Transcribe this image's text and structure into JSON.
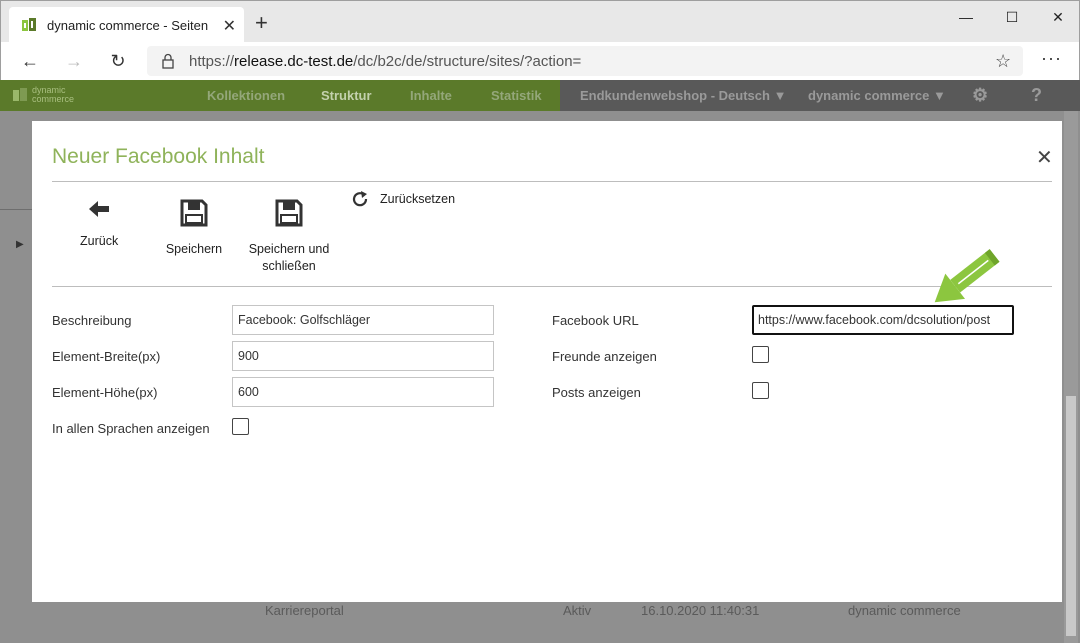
{
  "browser": {
    "tab_title": "dynamic commerce - Seiten",
    "url_prefix": "https://",
    "url_domain": "release.dc-test.de",
    "url_path": "/dc/b2c/de/structure/sites/?action="
  },
  "app": {
    "logo_line1": "dynamic",
    "logo_line2": "commerce",
    "nav": [
      "Kollektionen",
      "Struktur",
      "Inhalte",
      "Statistik"
    ],
    "shop_select": "Endkundenwebshop - Deutsch",
    "company_select": "dynamic commerce",
    "help": "?"
  },
  "background_row": {
    "name": "Karriereportal",
    "status": "Aktiv",
    "date": "16.10.2020 11:40:31",
    "owner": "dynamic commerce"
  },
  "modal": {
    "title": "Neuer Facebook Inhalt",
    "toolbar": {
      "back": "Zurück",
      "save": "Speichern",
      "save_close_1": "Speichern und",
      "save_close_2": "schließen",
      "reset": "Zurücksetzen"
    },
    "form": {
      "description_label": "Beschreibung",
      "description_value": "Facebook: Golfschläger",
      "width_label": "Element-Breite(px)",
      "width_value": "900",
      "height_label": "Element-Höhe(px)",
      "height_value": "600",
      "all_languages_label": "In allen Sprachen anzeigen",
      "fb_url_label": "Facebook URL",
      "fb_url_value": "https://www.facebook.com/dcsolution/post",
      "friends_label": "Freunde anzeigen",
      "posts_label": "Posts anzeigen"
    }
  },
  "colors": {
    "accent_green": "#8fb35a",
    "header_green": "#5b7a2a",
    "arrow_green": "#8cc63f"
  }
}
